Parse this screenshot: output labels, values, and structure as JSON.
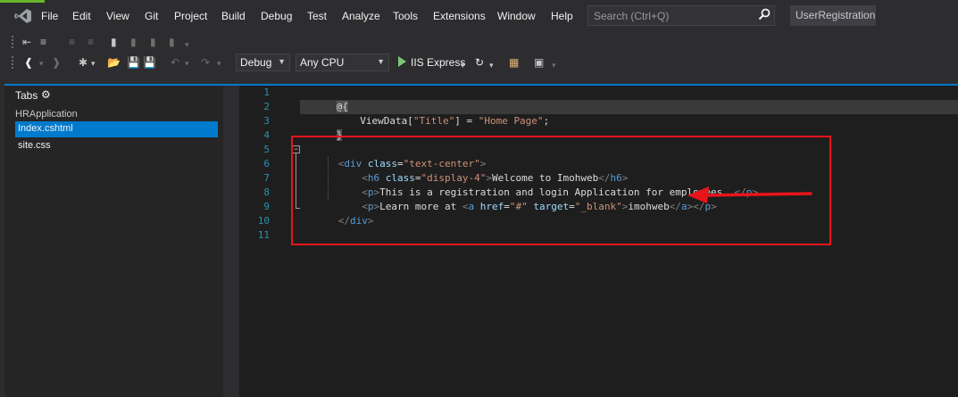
{
  "menubar": {
    "items": [
      "File",
      "Edit",
      "View",
      "Git",
      "Project",
      "Build",
      "Debug",
      "Test",
      "Analyze",
      "Tools",
      "Extensions",
      "Window",
      "Help"
    ],
    "search_placeholder": "Search (Ctrl+Q)",
    "solution_name": "UserRegistration"
  },
  "toolbar": {
    "configuration": "Debug",
    "platform": "Any CPU",
    "run_target": "IIS Express"
  },
  "tabs_panel": {
    "title": "Tabs",
    "project": "HRApplication",
    "files": [
      {
        "name": "Index.cshtml",
        "active": true
      },
      {
        "name": "site.css",
        "active": false
      }
    ]
  },
  "editor": {
    "line_numbers": [
      "1",
      "2",
      "3",
      "4",
      "5",
      "6",
      "7",
      "8",
      "9",
      "10",
      "11"
    ],
    "lines": [
      "@{",
      "    ViewData[\"Title\"] = \"Home Page\";",
      "}",
      "",
      "<div class=\"text-center\">",
      "    <h6 class=\"display-4\">Welcome to Imohweb</h6>",
      "    <p>This is a registration and login Application for employees  </p>",
      "    <p>Learn more at <a href=\"#\" target=\"_blank\">imohweb</a></p>",
      "</div>",
      "",
      ""
    ]
  },
  "colors": {
    "accent": "#007acc",
    "annotation": "#e8141c",
    "tag": "#569cd6",
    "attribute": "#9cdcfe",
    "string": "#ce9178",
    "line_number": "#2b91af"
  },
  "icons": [
    "vs-logo-icon",
    "search-icon",
    "gear-icon",
    "play-icon",
    "refresh-icon",
    "save-icon",
    "undo-icon",
    "redo-icon",
    "new-item-icon",
    "open-folder-icon",
    "bookmark-icon",
    "back-icon",
    "forward-icon",
    "collapse-icon"
  ]
}
